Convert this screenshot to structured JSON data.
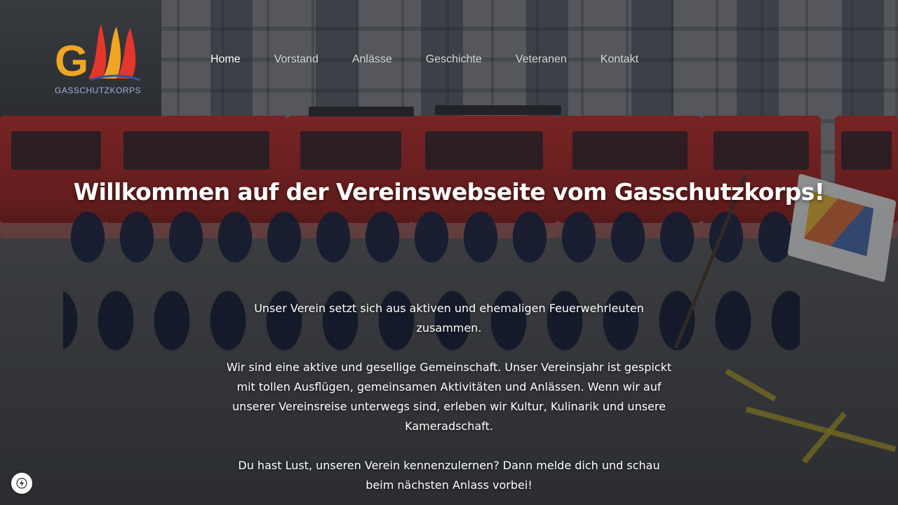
{
  "logo": {
    "text": "GASSCHUTZKORPS",
    "icon": "gasschutzkorps-logo-icon",
    "colors": {
      "orange": "#f0a623",
      "red": "#e4362b",
      "blue": "#2b55a5"
    }
  },
  "nav": {
    "items": [
      {
        "label": "Home",
        "active": true
      },
      {
        "label": "Vorstand",
        "active": false
      },
      {
        "label": "Anlässe",
        "active": false
      },
      {
        "label": "Geschichte",
        "active": false
      },
      {
        "label": "Veteranen",
        "active": false
      },
      {
        "label": "Kontakt",
        "active": false
      }
    ]
  },
  "hero": {
    "headline": "Willkommen auf der Vereinswebseite vom Gasschutzkorps!",
    "paragraphs": [
      "Unser Verein setzt sich aus aktiven und ehemaligen Feuerwehrleuten zusammen.",
      "Wir sind eine aktive und gesellige Gemeinschaft. Unser Vereinsjahr ist gespickt mit tollen Ausflügen, gemeinsamen Aktivitäten und Anlässen. Wenn wir auf unserer Vereinsreise unterwegs sind, erleben wir Kultur, Kulinarik und unsere Kameradschaft.",
      "Du hast Lust, unseren Verein kennenzulernen? Dann melde dich und schau beim nächsten Anlass vorbei!"
    ]
  },
  "badge": {
    "icon": "lightning-bolt-icon"
  }
}
